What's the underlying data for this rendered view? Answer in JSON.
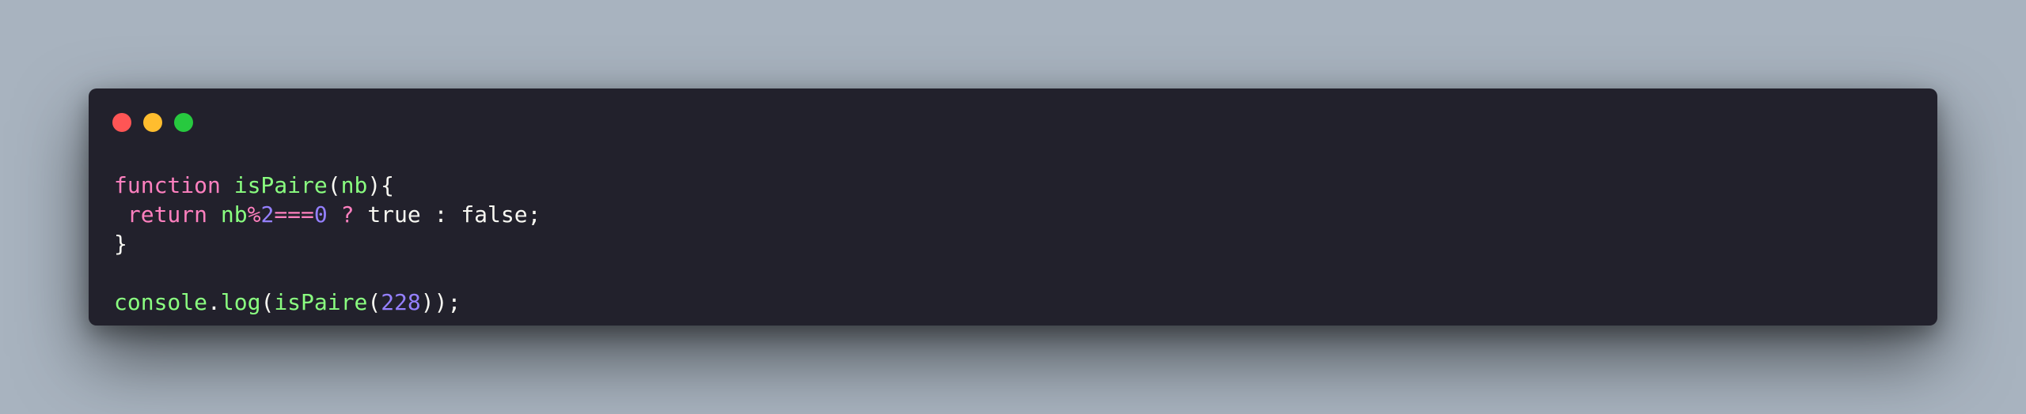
{
  "window": {
    "controls": [
      {
        "name": "close",
        "color": "#ff5555"
      },
      {
        "name": "minimize",
        "color": "#ffbd2e"
      },
      {
        "name": "maximize",
        "color": "#27c93f"
      }
    ]
  },
  "code": {
    "lines": [
      [
        {
          "t": "function",
          "c": "kw"
        },
        {
          "t": " ",
          "c": "plain"
        },
        {
          "t": "isPaire",
          "c": "fn"
        },
        {
          "t": "(",
          "c": "plain"
        },
        {
          "t": "nb",
          "c": "fn"
        },
        {
          "t": "){",
          "c": "plain"
        }
      ],
      [
        {
          "t": " ",
          "c": "plain"
        },
        {
          "t": "return",
          "c": "kw"
        },
        {
          "t": " ",
          "c": "plain"
        },
        {
          "t": "nb",
          "c": "fn"
        },
        {
          "t": "%",
          "c": "kw"
        },
        {
          "t": "2",
          "c": "num"
        },
        {
          "t": "===",
          "c": "kw"
        },
        {
          "t": "0",
          "c": "num"
        },
        {
          "t": " ",
          "c": "plain"
        },
        {
          "t": "?",
          "c": "kw"
        },
        {
          "t": " true : false;",
          "c": "plain"
        }
      ],
      [
        {
          "t": "}",
          "c": "plain"
        }
      ],
      [],
      [
        {
          "t": "console",
          "c": "fn"
        },
        {
          "t": ".",
          "c": "plain"
        },
        {
          "t": "log",
          "c": "fn"
        },
        {
          "t": "(",
          "c": "plain"
        },
        {
          "t": "isPaire",
          "c": "fn"
        },
        {
          "t": "(",
          "c": "plain"
        },
        {
          "t": "228",
          "c": "num"
        },
        {
          "t": "));",
          "c": "plain"
        }
      ]
    ]
  }
}
